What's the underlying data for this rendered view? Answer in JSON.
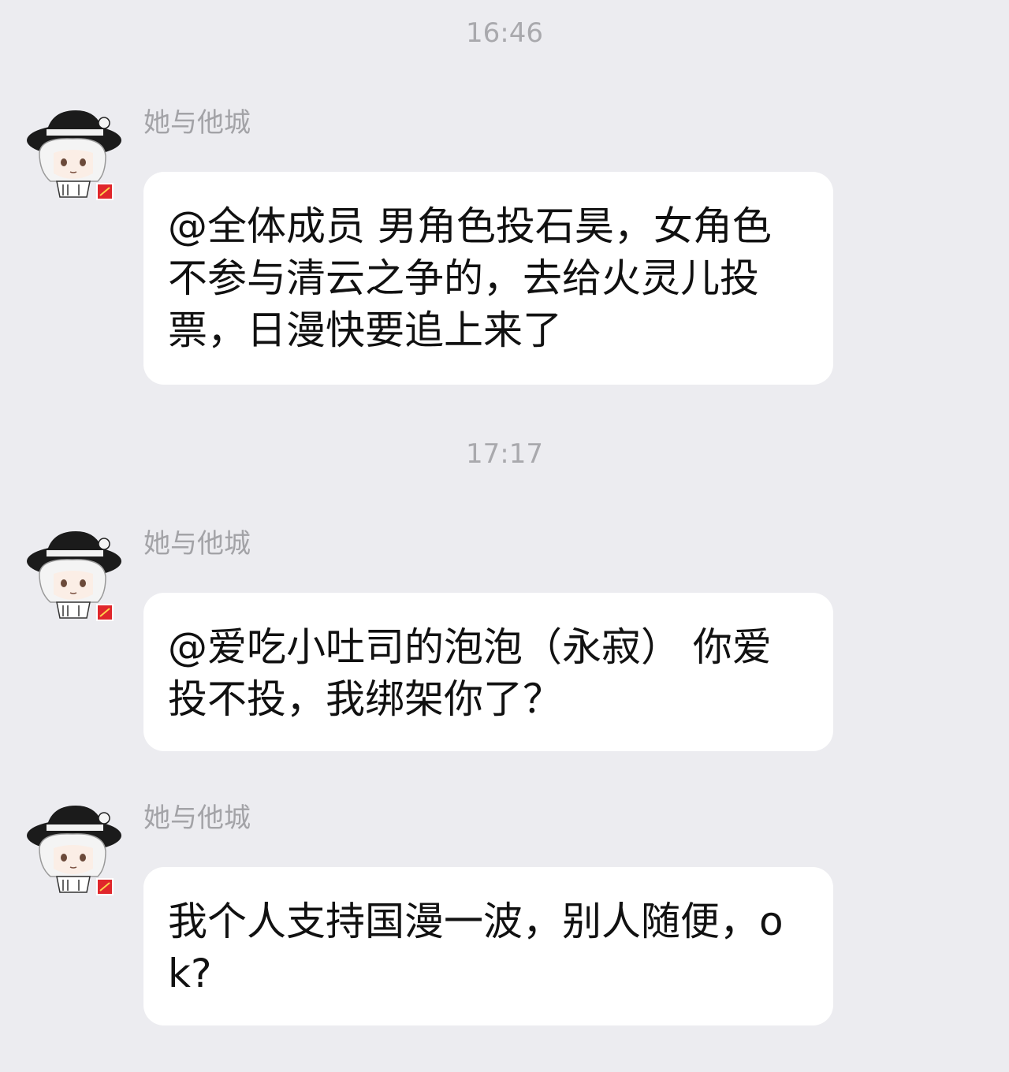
{
  "chat": {
    "timestamps": [
      "16:46",
      "17:17"
    ],
    "messages": [
      {
        "sender": "她与他城",
        "avatar_icon": "anime-girl-black-hat-avatar",
        "text": "@全体成员 男角色投石昊，女角色不参与清云之争的，去给火灵儿投票，日漫快要追上来了"
      },
      {
        "sender": "她与他城",
        "avatar_icon": "anime-girl-black-hat-avatar",
        "text": "@爱吃小吐司的泡泡（永寂） 你爱投不投，我绑架你了？"
      },
      {
        "sender": "她与他城",
        "avatar_icon": "anime-girl-black-hat-avatar",
        "text": "我个人支持国漫一波，别人随便，ok?"
      }
    ]
  },
  "colors": {
    "background": "#ececf0",
    "bubble": "#ffffff",
    "timestamp_text": "#a9a9ad",
    "sender_text": "#a3a3a7",
    "message_text": "#111111",
    "avatar_badge": "#e0262b"
  }
}
